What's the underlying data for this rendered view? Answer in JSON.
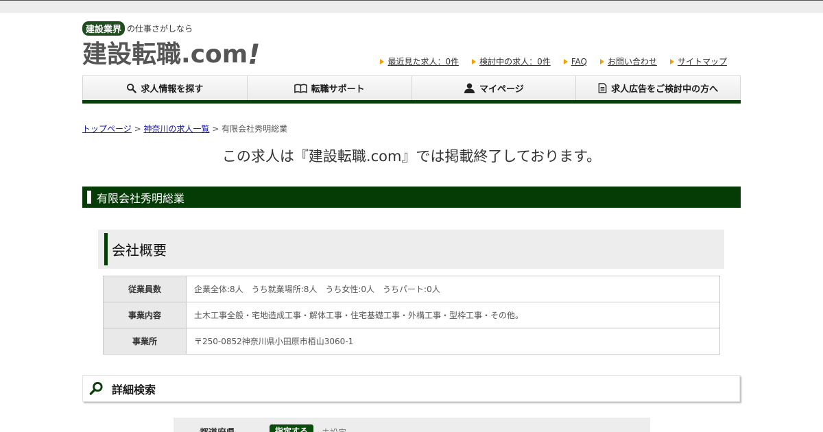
{
  "header": {
    "tagline_badge": "建設業界",
    "tagline_rest": "の仕事さがしなら",
    "logo_main": "建設転職",
    "logo_domain": ".com",
    "logo_bang": "!"
  },
  "utility_links": [
    {
      "label": "最近見た求人：0件"
    },
    {
      "label": "検討中の求人：0件"
    },
    {
      "label": "FAQ"
    },
    {
      "label": "お問い合わせ"
    },
    {
      "label": "サイトマップ"
    }
  ],
  "nav": [
    {
      "label": "求人情報を探す",
      "icon": "search-icon"
    },
    {
      "label": "転職サポート",
      "icon": "book-icon"
    },
    {
      "label": "マイページ",
      "icon": "user-icon"
    },
    {
      "label": "求人広告をご検討中の方へ",
      "icon": "document-icon"
    }
  ],
  "breadcrumb": {
    "home": "トップページ",
    "sep1": " > ",
    "region": "神奈川の求人一覧",
    "sep2": " > ",
    "current": "有限会社秀明総業"
  },
  "notice": "この求人は『建設転職.com』では掲載終了しております。",
  "company_name": "有限会社秀明総業",
  "overview": {
    "title": "会社概要",
    "rows": [
      {
        "label": "従業員数",
        "value": "企業全体:8人　うち就業場所:8人　うち女性:0人　うちパート:0人"
      },
      {
        "label": "事業内容",
        "value": "土木工事全般・宅地造成工事・解体工事・住宅基礎工事・外構工事・型枠工事・その他。"
      },
      {
        "label": "事業所",
        "value": "〒250-0852神奈川県小田原市栢山3060-1"
      }
    ]
  },
  "search": {
    "title": "詳細検索",
    "filter_label": "都道府県",
    "filter_button": "指定する",
    "filter_value": "未設定"
  },
  "colors": {
    "brand_green": "#053b05",
    "accent_orange": "#f0a000"
  }
}
